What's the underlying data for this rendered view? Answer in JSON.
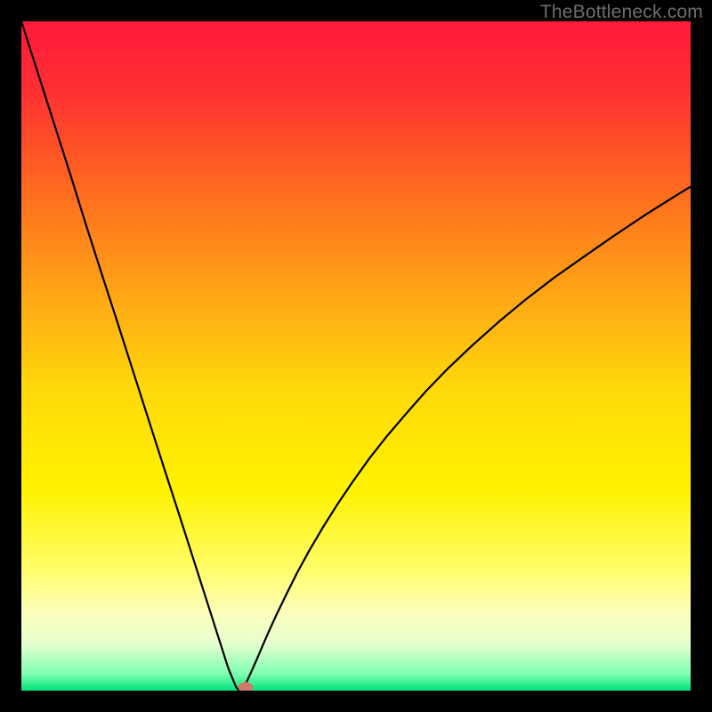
{
  "watermark": "TheBottleneck.com",
  "chart_data": {
    "type": "line",
    "title": "",
    "xlabel": "",
    "ylabel": "",
    "xlim": [
      0,
      100
    ],
    "ylim": [
      0,
      100
    ],
    "grid": false,
    "legend": false,
    "background_gradient": {
      "stops": [
        {
          "offset": 0.0,
          "color": "#ff1a3a"
        },
        {
          "offset": 0.1,
          "color": "#ff2e33"
        },
        {
          "offset": 0.25,
          "color": "#ff6a1f"
        },
        {
          "offset": 0.4,
          "color": "#ffa316"
        },
        {
          "offset": 0.55,
          "color": "#ffd90a"
        },
        {
          "offset": 0.7,
          "color": "#fff200"
        },
        {
          "offset": 0.82,
          "color": "#fffd6a"
        },
        {
          "offset": 0.88,
          "color": "#fdffb8"
        },
        {
          "offset": 0.93,
          "color": "#e6ffcf"
        },
        {
          "offset": 0.975,
          "color": "#7dffb0"
        },
        {
          "offset": 1.0,
          "color": "#00e37a"
        }
      ]
    },
    "series": [
      {
        "name": "bottleneck-curve",
        "color": "#000000",
        "x": [
          0.0,
          2.4,
          4.8,
          7.2,
          9.5,
          11.9,
          14.3,
          16.7,
          19.1,
          21.5,
          23.9,
          26.3,
          28.7,
          30.9,
          32.1,
          32.6,
          33.0,
          33.6,
          34.3,
          35.1,
          36.0,
          37.0,
          38.1,
          39.6,
          41.2,
          43.0,
          45.0,
          47.2,
          49.5,
          52.0,
          54.6,
          57.5,
          60.5,
          63.8,
          67.4,
          71.2,
          75.3,
          79.6,
          84.0,
          88.6,
          93.4,
          98.5,
          100.0
        ],
        "y": [
          100.0,
          92.5,
          85.0,
          77.5,
          70.1,
          62.6,
          55.2,
          47.7,
          40.2,
          32.7,
          25.3,
          17.8,
          10.3,
          3.4,
          0.5,
          0.0,
          0.2,
          1.2,
          2.7,
          4.5,
          6.6,
          8.9,
          11.3,
          14.4,
          17.6,
          20.9,
          24.3,
          27.8,
          31.2,
          34.7,
          38.0,
          41.4,
          44.8,
          48.2,
          51.6,
          55.0,
          58.4,
          61.7,
          64.8,
          68.0,
          71.2,
          74.4,
          75.3
        ]
      }
    ],
    "marker": {
      "name": "current-point",
      "shape": "ellipse",
      "x": 33.5,
      "y": 0.5,
      "rx": 1.1,
      "ry": 0.8,
      "color": "#cf7a6a"
    }
  }
}
